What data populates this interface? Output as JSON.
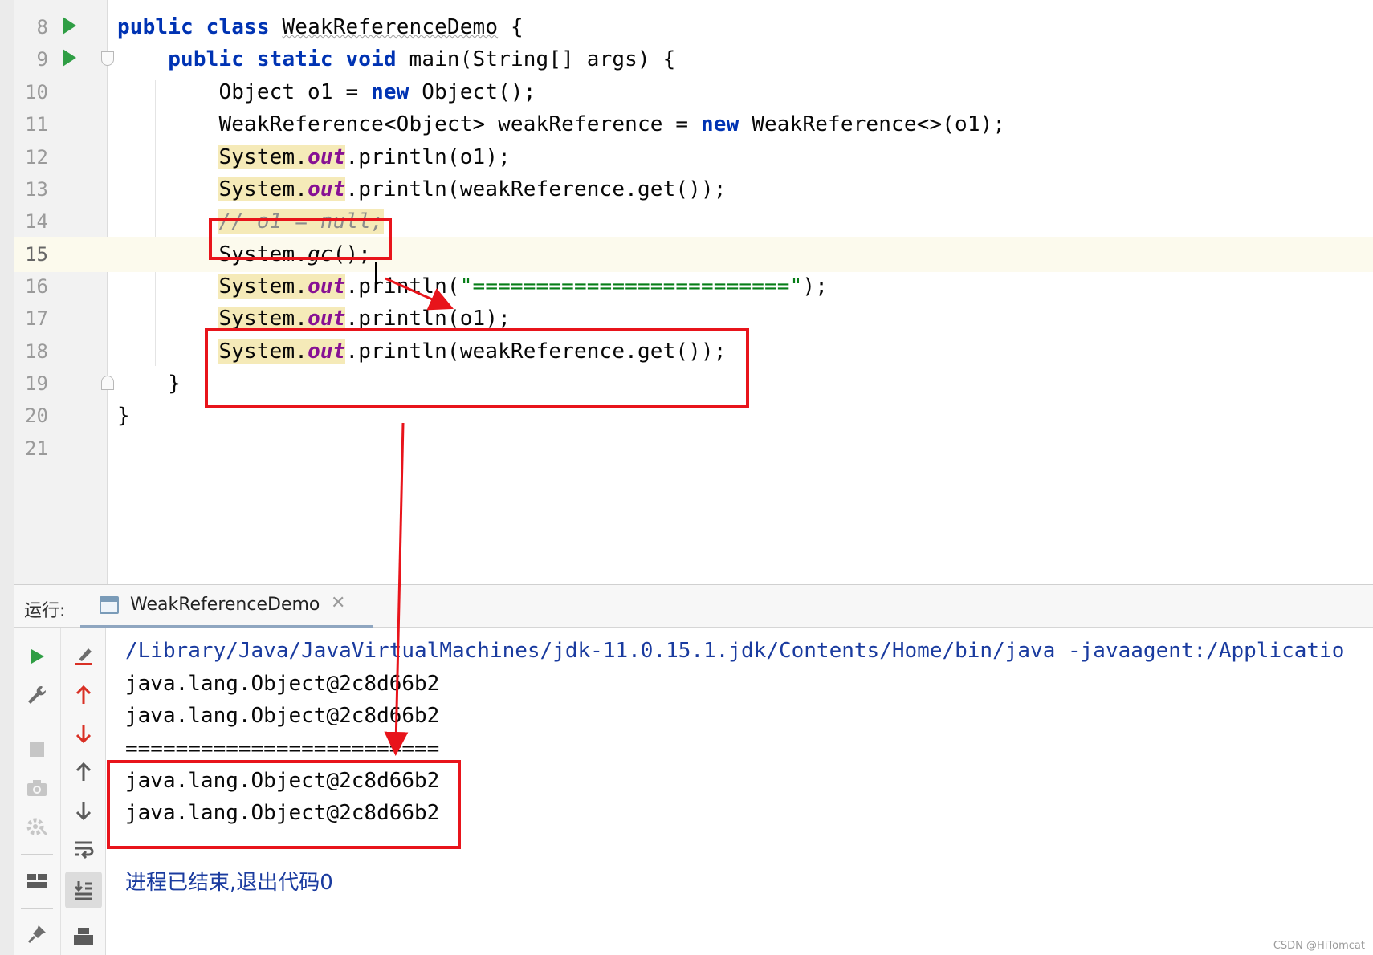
{
  "editor": {
    "lines": [
      {
        "n": "8"
      },
      {
        "n": "9"
      },
      {
        "n": "10"
      },
      {
        "n": "11"
      },
      {
        "n": "12"
      },
      {
        "n": "13"
      },
      {
        "n": "14"
      },
      {
        "n": "15"
      },
      {
        "n": "16"
      },
      {
        "n": "17"
      },
      {
        "n": "18"
      },
      {
        "n": "19"
      },
      {
        "n": "20"
      },
      {
        "n": "21"
      }
    ],
    "code": {
      "l8": {
        "kw1": "public",
        "kw2": "class",
        "name": "WeakReferenceDemo",
        "rest": " {"
      },
      "l9": {
        "kw1": "public",
        "kw2": "static",
        "kw3": "void",
        "rest": " main(String[] args) {"
      },
      "l10": {
        "a": "Object o1 = ",
        "kw": "new",
        "b": " Object();"
      },
      "l11": {
        "a": "WeakReference<Object> weakReference = ",
        "kw": "new",
        "b": " WeakReference<>(o1);"
      },
      "l12": {
        "cls": "System.",
        "fld": "out",
        "rest": ".println(o1);"
      },
      "l13": {
        "cls": "System.",
        "fld": "out",
        "rest": ".println(weakReference.get());"
      },
      "l14": {
        "comment": "// o1 = null;"
      },
      "l15": {
        "cls": "System.",
        "mth": "gc",
        "rest": "();"
      },
      "l16": {
        "cls": "System.",
        "fld": "out",
        "rest": ".println(",
        "str": "\"=========================\"",
        "end": ");"
      },
      "l17": {
        "cls": "System.",
        "fld": "out",
        "rest": ".println(o1);"
      },
      "l18": {
        "cls": "System.",
        "fld": "out",
        "rest": ".println(weakReference.get());"
      },
      "l19": {
        "text": "}"
      },
      "l20": {
        "text": "}"
      }
    }
  },
  "run_panel": {
    "label": "运行:",
    "tab_title": "WeakReferenceDemo",
    "tab_close": "✕"
  },
  "console": {
    "path": "/Library/Java/JavaVirtualMachines/jdk-11.0.15.1.jdk/Contents/Home/bin/java -javaagent:/Applicatio",
    "out1": "java.lang.Object@2c8d66b2",
    "out2": "java.lang.Object@2c8d66b2",
    "separator": "=========================",
    "out3": "java.lang.Object@2c8d66b2",
    "out4": "java.lang.Object@2c8d66b2",
    "exit_message": "进程已结束,退出代码0"
  },
  "toolbar_icons": {
    "left": [
      "run-icon",
      "wrench-icon",
      "stop-icon",
      "camera-icon",
      "settings-icon",
      "layout-icon",
      "pin-icon"
    ],
    "right": [
      "clear-icon",
      "up-red-icon",
      "down-red-icon",
      "up-icon",
      "down-icon",
      "wrap-icon",
      "scroll-to-end-icon",
      "print-icon"
    ]
  },
  "colors": {
    "annotation_red": "#e8141b",
    "keyword": "#0033b3",
    "field": "#871094",
    "string": "#067d17",
    "comment": "#8c8c8c",
    "usage_highlight": "#f5eab8",
    "caret_row": "#fcfaed"
  },
  "watermark": "CSDN @HiTomcat"
}
